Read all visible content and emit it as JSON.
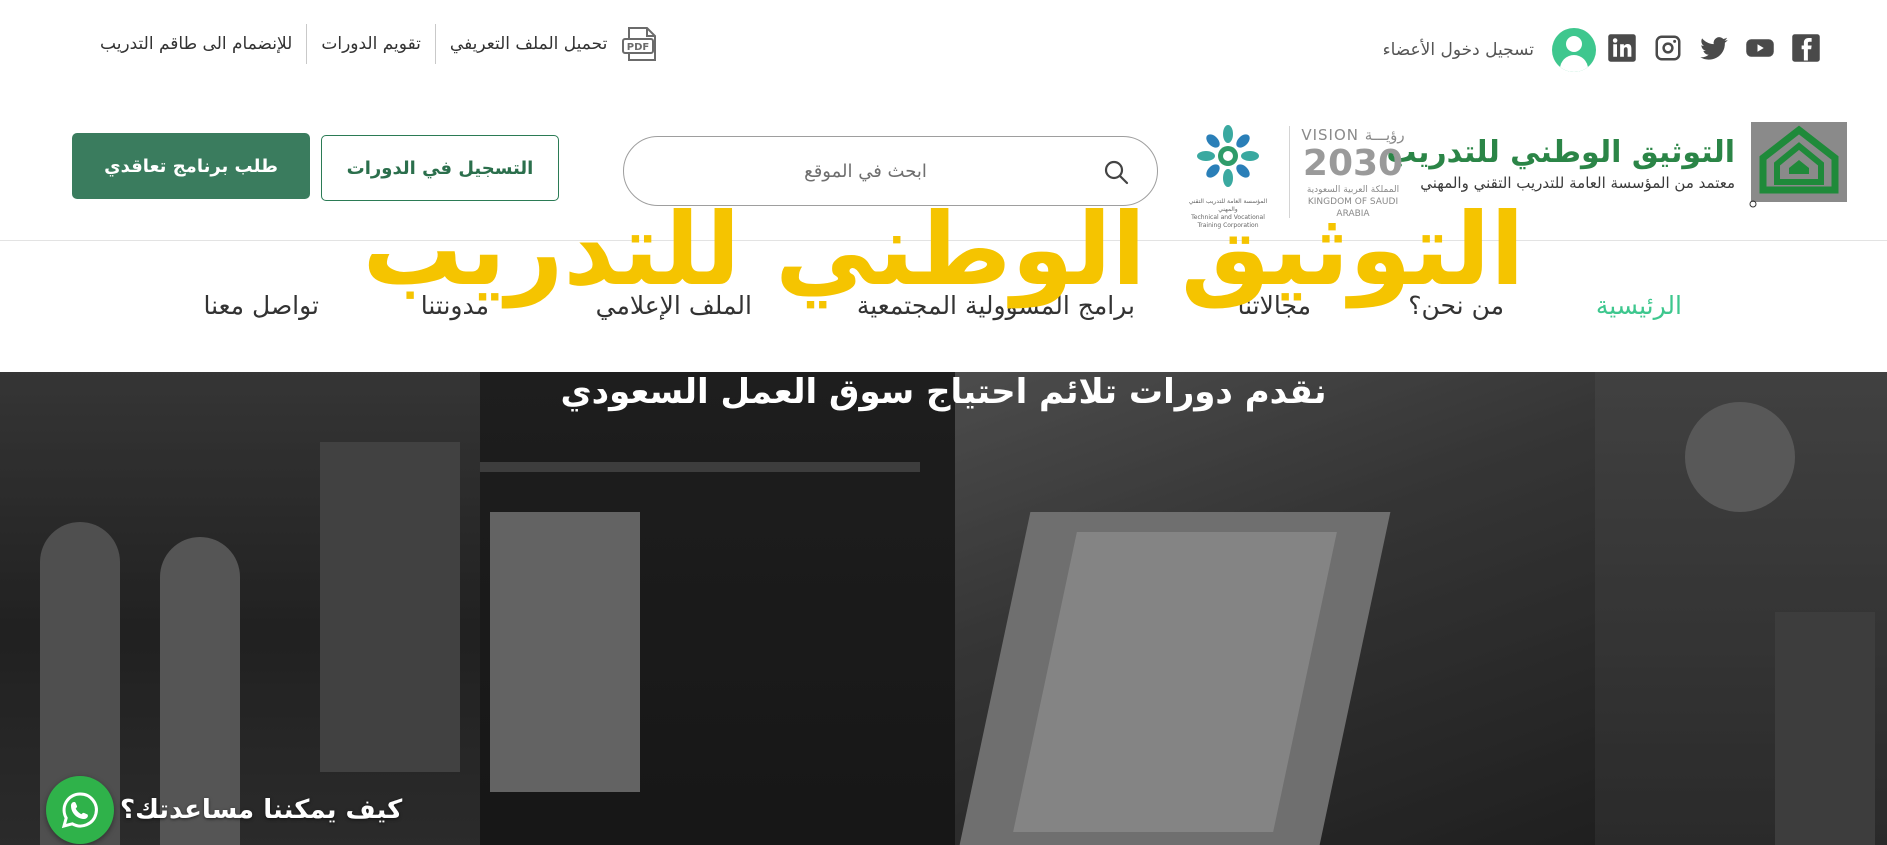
{
  "topbar": {
    "social": [
      "facebook-icon",
      "youtube-icon",
      "twitter-icon",
      "instagram-icon",
      "linkedin-icon"
    ],
    "member_login": "تسجيل دخول الأعضاء",
    "links": {
      "download_profile": "تحميل الملف التعريفي",
      "course_calendar": "تقويم الدورات",
      "join_trainers": "للإنضمام الى طاقم التدريب"
    },
    "pdf_label": "PDF"
  },
  "header": {
    "logo_title": "التوثيق الوطني للتدريب",
    "logo_subtitle": "معتمد من المؤسسة العامة للتدريب التقني والمهني",
    "vision": {
      "line1": "VISION رؤيـــة",
      "year": "2030",
      "line3": "المملكة العربية السعودية",
      "line4": "KINGDOM OF SAUDI ARABIA"
    },
    "tvtc_caption_ar": "المؤسسة العامة للتدريب التقني والمهني",
    "tvtc_caption_en": "Technical and Vocational Training Corporation",
    "search_placeholder": "ابحث في الموقع",
    "register_courses": "التسجيل في الدورات",
    "contract_request": "طلب برنامج تعاقدي"
  },
  "nav": {
    "items": [
      {
        "label": "الرئيسية",
        "active": true
      },
      {
        "label": "من نحن؟",
        "active": false
      },
      {
        "label": "مجالاتنا",
        "active": false
      },
      {
        "label": "برامج المسؤولية المجتمعية",
        "active": false
      },
      {
        "label": "الملف الإعلامي",
        "active": false
      },
      {
        "label": "مدونتنا",
        "active": false
      },
      {
        "label": "تواصل معنا",
        "active": false
      }
    ]
  },
  "hero": {
    "title": "التوثيق الوطني للتدريب",
    "subtitle": "نقدم دورات تلائم احتياج سوق العمل السعودي"
  },
  "whatsapp": {
    "text": "كيف يمكننا مساعدتك؟"
  },
  "colors": {
    "brand_green": "#2b8547",
    "active_nav": "#3ec78e",
    "button_green": "#3a7c5e",
    "hero_title": "#f5c400",
    "whatsapp": "#2fb24a"
  }
}
